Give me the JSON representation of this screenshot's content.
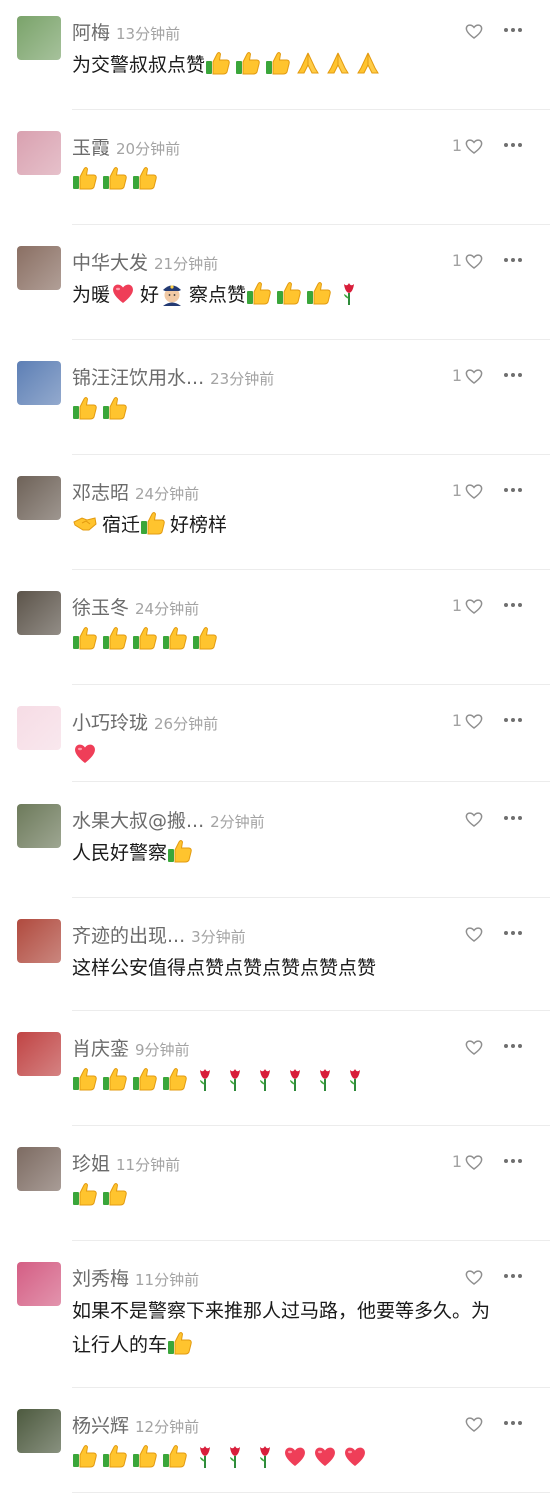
{
  "comments": [
    {
      "name": "阿梅",
      "time": "13分钟前",
      "likes": "",
      "text_parts": [
        {
          "t": "为交警叔叔点赞"
        },
        {
          "e": "thumb"
        },
        {
          "e": "thumb"
        },
        {
          "e": "thumb"
        },
        {
          "e": "pray"
        },
        {
          "e": "pray"
        },
        {
          "e": "pray"
        }
      ],
      "avatar": "#7aa36a"
    },
    {
      "name": "玉霞",
      "time": "20分钟前",
      "likes": "1",
      "text_parts": [
        {
          "e": "thumb"
        },
        {
          "e": "thumb"
        },
        {
          "e": "thumb"
        }
      ],
      "avatar": "#d9a1b0"
    },
    {
      "name": "中华大发",
      "time": "21分钟前",
      "likes": "1",
      "text_parts": [
        {
          "t": "为暖"
        },
        {
          "e": "heart"
        },
        {
          "t": "好"
        },
        {
          "e": "police"
        },
        {
          "t": "察点赞"
        },
        {
          "e": "thumb"
        },
        {
          "e": "thumb"
        },
        {
          "e": "thumb"
        },
        {
          "e": "rose"
        }
      ],
      "avatar": "#8a6f63"
    },
    {
      "name": "锦汪汪饮用水...",
      "time": "23分钟前",
      "likes": "1",
      "text_parts": [
        {
          "e": "thumb"
        },
        {
          "e": "thumb"
        }
      ],
      "avatar": "#5d7fb5"
    },
    {
      "name": "邓志昭",
      "time": "24分钟前",
      "likes": "1",
      "text_parts": [
        {
          "e": "handshake"
        },
        {
          "t": "宿迁"
        },
        {
          "e": "thumb"
        },
        {
          "t": "好榜样"
        }
      ],
      "avatar": "#6e6258"
    },
    {
      "name": "徐玉冬",
      "time": "24分钟前",
      "likes": "1",
      "text_parts": [
        {
          "e": "thumb"
        },
        {
          "e": "thumb"
        },
        {
          "e": "thumb"
        },
        {
          "e": "thumb"
        },
        {
          "e": "thumb"
        }
      ],
      "avatar": "#5c544a"
    },
    {
      "name": "小巧玲珑",
      "time": "26分钟前",
      "likes": "1",
      "text_parts": [
        {
          "e": "heart"
        }
      ],
      "avatar": "#f6dce5"
    },
    {
      "name": "水果大叔@搬...",
      "time": "2分钟前",
      "likes": "",
      "text_parts": [
        {
          "t": "人民好警察"
        },
        {
          "e": "thumb"
        }
      ],
      "avatar": "#6d7a5b"
    },
    {
      "name": "齐迹的出现...",
      "time": "3分钟前",
      "likes": "",
      "text_parts": [
        {
          "t": "这样公安值得点赞点赞点赞点赞点赞"
        }
      ],
      "avatar": "#b04a3e"
    },
    {
      "name": "肖庆銮",
      "time": "9分钟前",
      "likes": "",
      "text_parts": [
        {
          "e": "thumb"
        },
        {
          "e": "thumb"
        },
        {
          "e": "thumb"
        },
        {
          "e": "thumb"
        },
        {
          "e": "rose"
        },
        {
          "e": "rose"
        },
        {
          "e": "rose"
        },
        {
          "e": "rose"
        },
        {
          "e": "rose"
        },
        {
          "e": "rose"
        }
      ],
      "avatar": "#c04444"
    },
    {
      "name": "珍姐",
      "time": "11分钟前",
      "likes": "1",
      "text_parts": [
        {
          "e": "thumb"
        },
        {
          "e": "thumb"
        }
      ],
      "avatar": "#7d6b62"
    },
    {
      "name": "刘秀梅",
      "time": "11分钟前",
      "likes": "",
      "text_parts": [
        {
          "t": "如果不是警察下来推那人过马路，他要等多久。为让行人的车"
        },
        {
          "e": "thumb"
        }
      ],
      "avatar": "#d45e84"
    },
    {
      "name": "杨兴辉",
      "time": "12分钟前",
      "likes": "",
      "text_parts": [
        {
          "e": "thumb"
        },
        {
          "e": "thumb"
        },
        {
          "e": "thumb"
        },
        {
          "e": "thumb"
        },
        {
          "e": "rose"
        },
        {
          "e": "rose"
        },
        {
          "e": "rose"
        },
        {
          "e": "heart"
        },
        {
          "e": "heart"
        },
        {
          "e": "heart"
        }
      ],
      "avatar": "#4d5a3f"
    }
  ],
  "icons": {
    "like": "heart-outline-icon",
    "more": "more-dots-icon"
  },
  "colors": {
    "name": "#6b6b6b",
    "time": "#a3a3a3",
    "text": "#1a1a1a",
    "divider": "#ececec"
  }
}
